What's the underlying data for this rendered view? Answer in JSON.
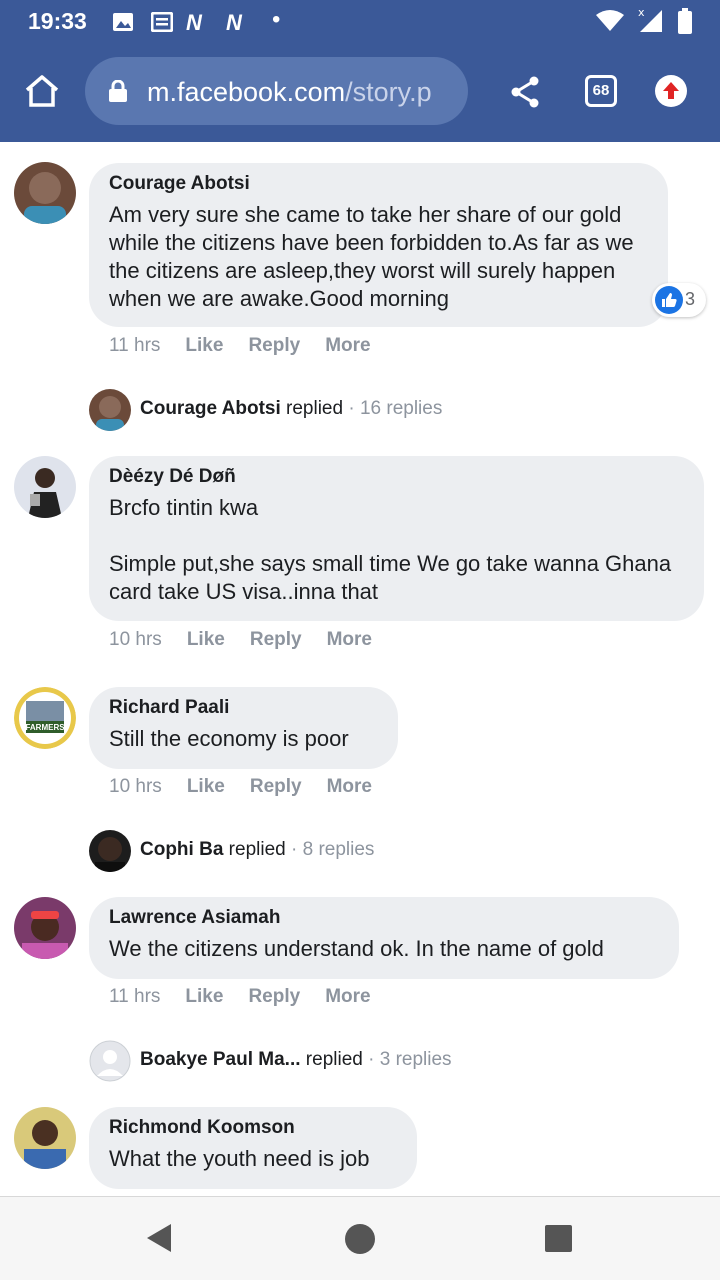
{
  "status_bar": {
    "time": "19:33",
    "notification_icons": [
      "image-icon",
      "news-icon",
      "n-icon",
      "n-icon"
    ],
    "system_icons": [
      "wifi-icon",
      "signal-icon",
      "battery-icon"
    ]
  },
  "browser": {
    "url_domain": "m.facebook.com",
    "url_path": "/story.p",
    "tab_count": "68",
    "accent": "#3b5998"
  },
  "comments": [
    {
      "author": "Courage Abotsi",
      "text": "Am very sure she came to take her share of our gold while the citizens have been forbidden to.As far as we the citizens are asleep,they worst will surely happen when we are awake.Good morning",
      "time": "11 hrs",
      "like_count": "3",
      "reply": {
        "author": "Courage Abotsi",
        "verb": "replied",
        "count": "· 16 replies"
      }
    },
    {
      "author": "Dèézy Dé Døñ",
      "text": "Brcfo tintin kwa\n\nSimple put,she says small time We go take wanna Ghana card take US visa..inna that",
      "time": "10 hrs"
    },
    {
      "author": "Richard Paali",
      "text": "Still the economy is poor",
      "time": "10 hrs",
      "reply": {
        "author": "Cophi Ba",
        "verb": "replied",
        "count": "· 8 replies"
      }
    },
    {
      "author": "Lawrence Asiamah",
      "text": "We the citizens understand ok. In the name of gold",
      "time": "11 hrs",
      "reply": {
        "author": "Boakye Paul Ma...",
        "verb": "replied",
        "count": "· 3 replies"
      }
    },
    {
      "author": "Richmond Koomson",
      "text": "What the youth need is job"
    }
  ],
  "actions": {
    "like": "Like",
    "reply": "Reply",
    "more": "More"
  },
  "avatar_caption": "FARMERS"
}
